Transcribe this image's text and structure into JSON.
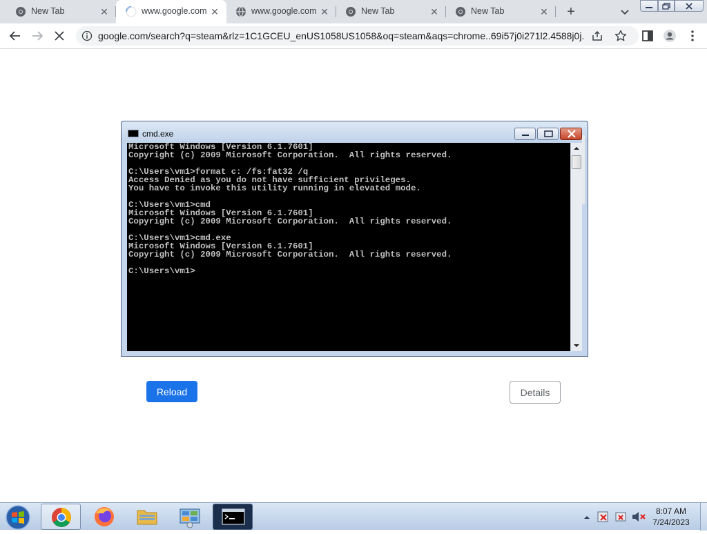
{
  "browser": {
    "tabs": [
      {
        "label": "New Tab",
        "icon": "chrome-icon"
      },
      {
        "label": "www.google.com",
        "icon": "loading-spinner-icon"
      },
      {
        "label": "www.google.com",
        "icon": "globe-icon"
      },
      {
        "label": "New Tab",
        "icon": "chrome-icon"
      },
      {
        "label": "New Tab",
        "icon": "chrome-icon"
      }
    ],
    "active_tab_index": 1,
    "url": "google.com/search?q=steam&rlz=1C1GCEU_enUS1058US1058&oq=steam&aqs=chrome..69i57j0i271l2.4588j0j..."
  },
  "cmd_window": {
    "title": "cmd.exe",
    "lines": [
      "Microsoft Windows [Version 6.1.7601]",
      "Copyright (c) 2009 Microsoft Corporation.  All rights reserved.",
      "",
      "C:\\Users\\vm1>format c: /fs:fat32 /q",
      "Access Denied as you do not have sufficient privileges.",
      "You have to invoke this utility running in elevated mode.",
      "",
      "C:\\Users\\vm1>cmd",
      "Microsoft Windows [Version 6.1.7601]",
      "Copyright (c) 2009 Microsoft Corporation.  All rights reserved.",
      "",
      "C:\\Users\\vm1>cmd.exe",
      "Microsoft Windows [Version 6.1.7601]",
      "Copyright (c) 2009 Microsoft Corporation.  All rights reserved.",
      "",
      "C:\\Users\\vm1>"
    ]
  },
  "page": {
    "reload_label": "Reload",
    "details_label": "Details"
  },
  "taskbar": {
    "apps": [
      "chrome-icon",
      "firefox-icon",
      "file-explorer-icon",
      "control-panel-icon",
      "cmd-icon"
    ],
    "time": "8:07 AM",
    "date": "7/24/2023"
  },
  "colors": {
    "accent": "#1a73e8",
    "tabstrip": "#dee1e6",
    "console_bg": "#000000",
    "console_text": "#c0c0c0"
  }
}
